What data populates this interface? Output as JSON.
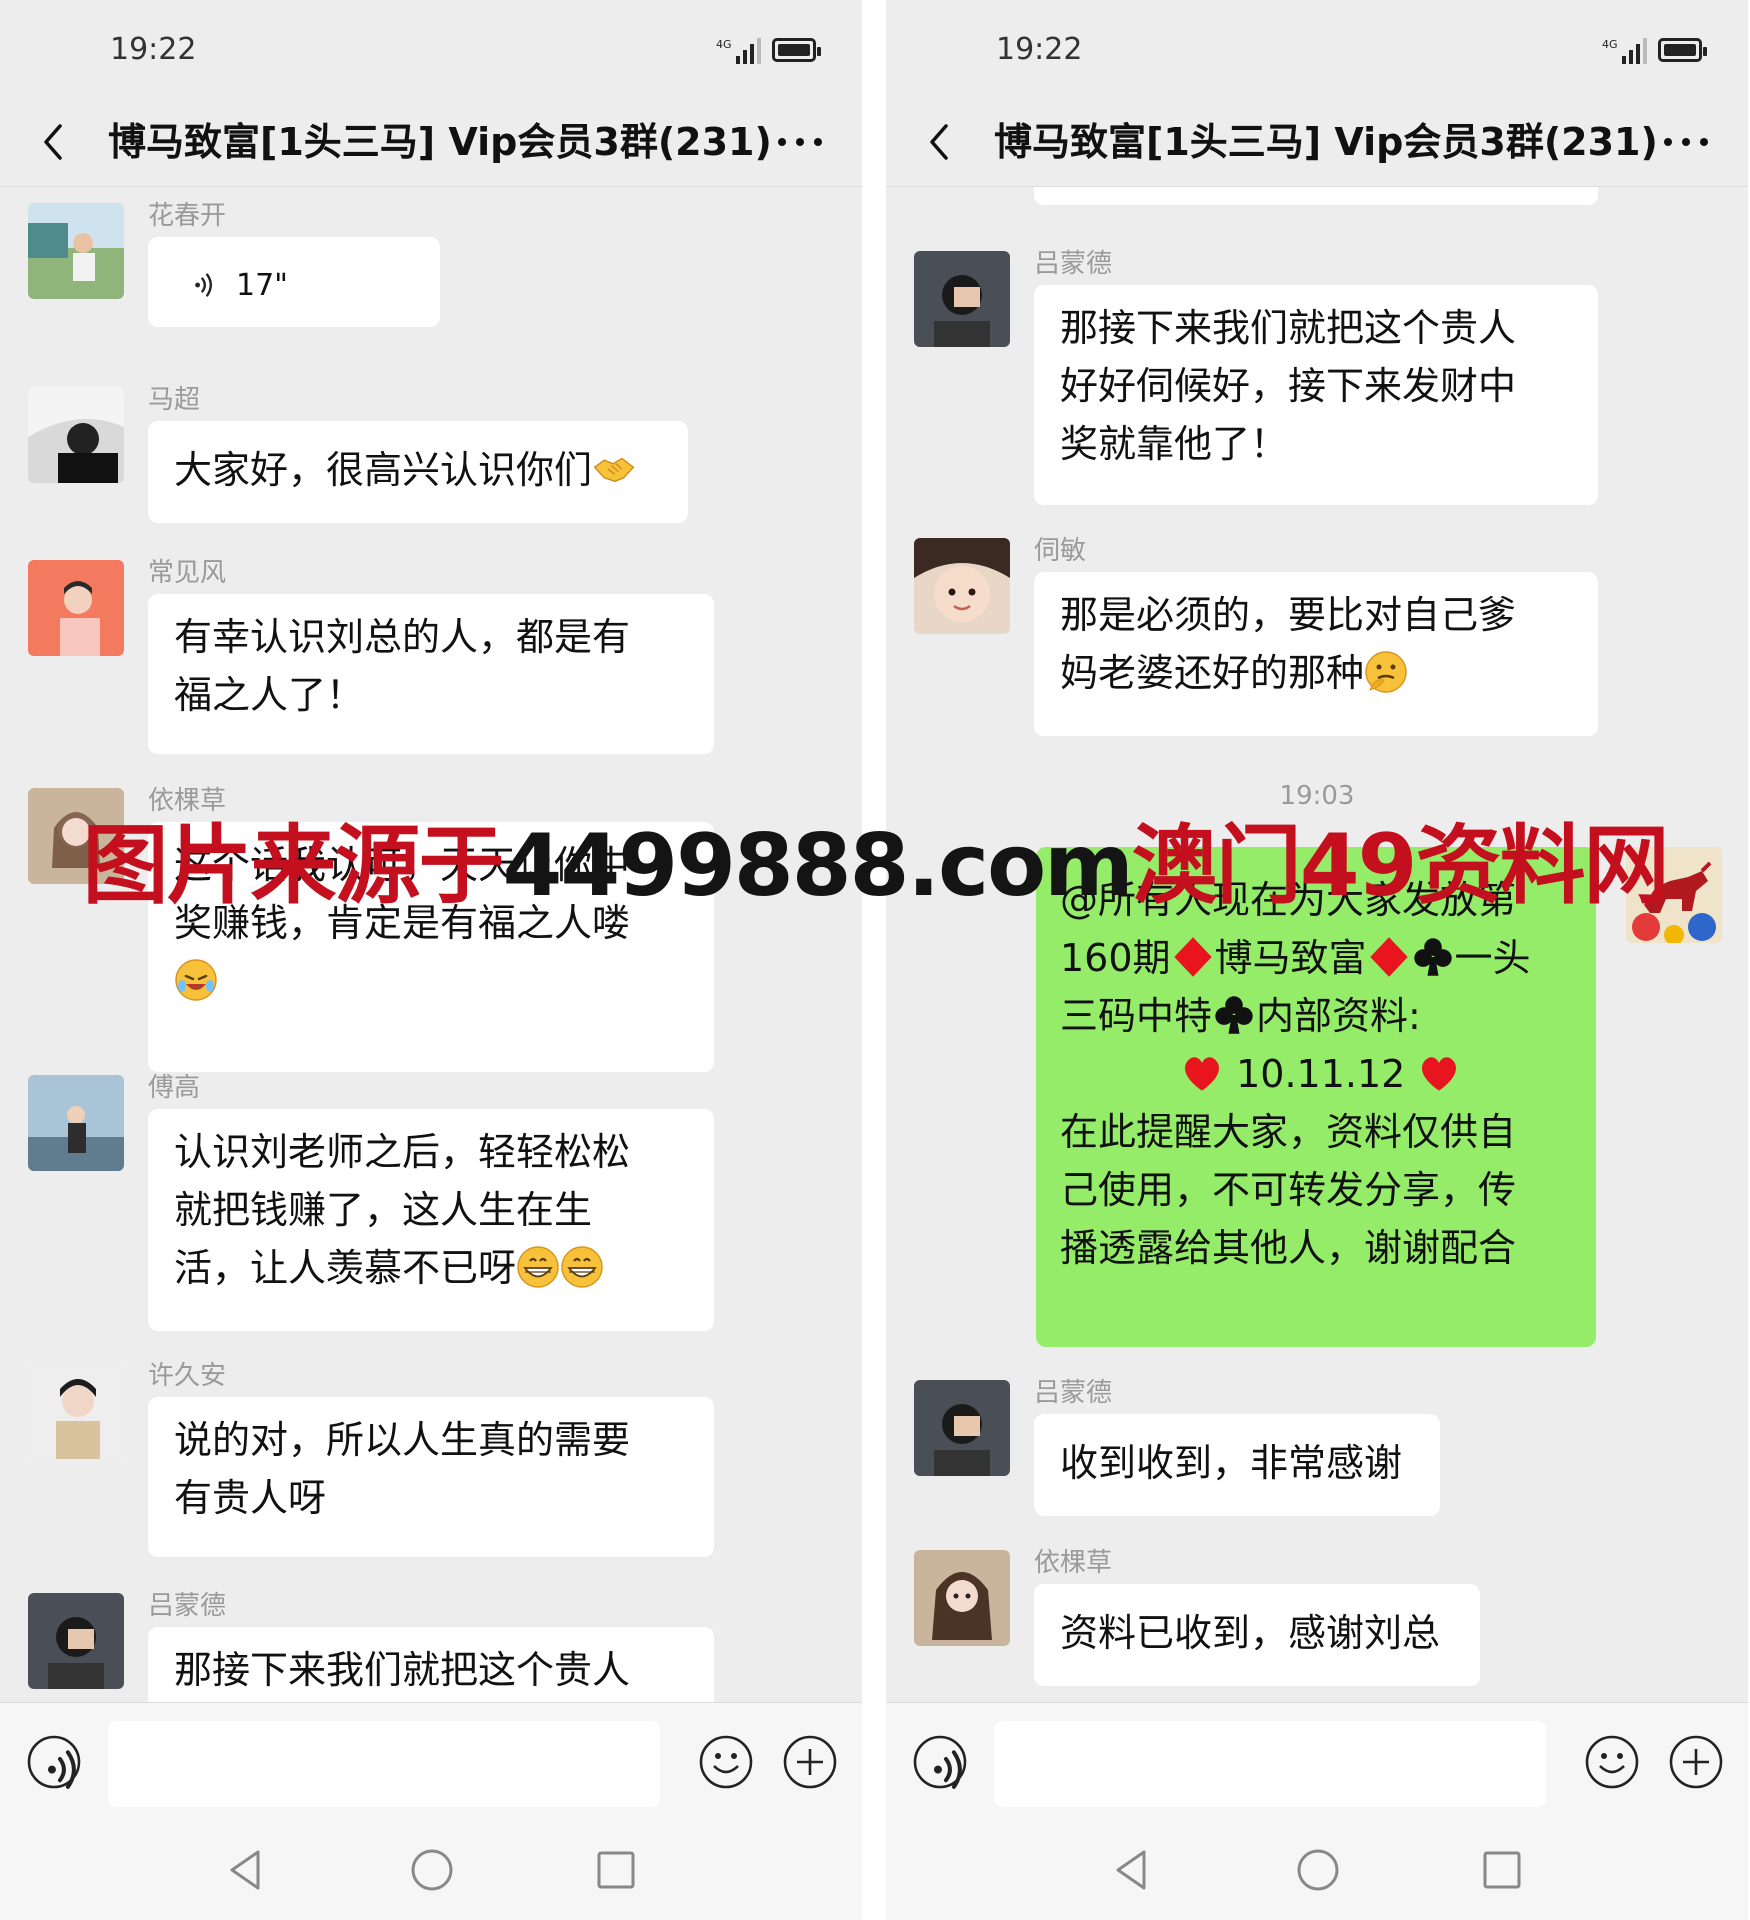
{
  "status": {
    "time": "19:22",
    "network": "4G"
  },
  "chat": {
    "title": "博马致富[1头三马] Vip会员3群(231)"
  },
  "left": {
    "messages": [
      {
        "sender": "花春开",
        "voice": "17\""
      },
      {
        "sender": "马超",
        "text": "大家好，很高兴认识你们"
      },
      {
        "sender": "常见风",
        "lines": [
          "有幸认识刘总的人，都是有",
          "福之人了！"
        ]
      },
      {
        "sender": "依棵草",
        "lines": [
          "这个话我认可，天天让你中",
          "奖赚钱，肯定是有福之人喽"
        ]
      },
      {
        "sender": "傅高",
        "lines": [
          "认识刘老师之后，轻轻松松",
          "就把钱赚了，这人生在生",
          "活，让人羡慕不已呀"
        ]
      },
      {
        "sender": "许久安",
        "lines": [
          "说的对，所以人生真的需要",
          "有贵人呀"
        ]
      },
      {
        "sender": "吕蒙德",
        "lines": [
          "那接下来我们就把这个贵人"
        ]
      }
    ]
  },
  "right": {
    "messages": [
      {
        "sender": "吕蒙德",
        "lines": [
          "那接下来我们就把这个贵人",
          "好好伺候好，接下来发财中",
          "奖就靠他了！"
        ]
      },
      {
        "sender": "伺敏",
        "lines": [
          "那是必须的，要比对自己爹",
          "妈老婆还好的那种"
        ]
      }
    ],
    "timestamp": "19:03",
    "own_message": {
      "line1": "@所有人现在为大家发放第",
      "line2_a": "160期",
      "line2_b": "博马致富",
      "line2_c": "一头",
      "line3_a": "三码中特",
      "line3_b": "内部资料:",
      "numbers": "10.11.12",
      "line5": "在此提醒大家，资料仅供自",
      "line6": "己使用，不可转发分享，传",
      "line7": "播透露给其他人，谢谢配合"
    },
    "messages_after": [
      {
        "sender": "吕蒙德",
        "text": "收到收到，非常感谢"
      },
      {
        "sender": "依棵草",
        "text": "资料已收到，感谢刘总"
      }
    ]
  },
  "watermark": {
    "part1": "图片来源于",
    "part2": "4499888.com",
    "part3": "澳门49资料网"
  },
  "colors": {
    "background": "#ededed",
    "own_bubble": "#95ec69",
    "watermark_red": "#c4101e",
    "diamond": "#e8141e",
    "heart": "#e8141e"
  }
}
